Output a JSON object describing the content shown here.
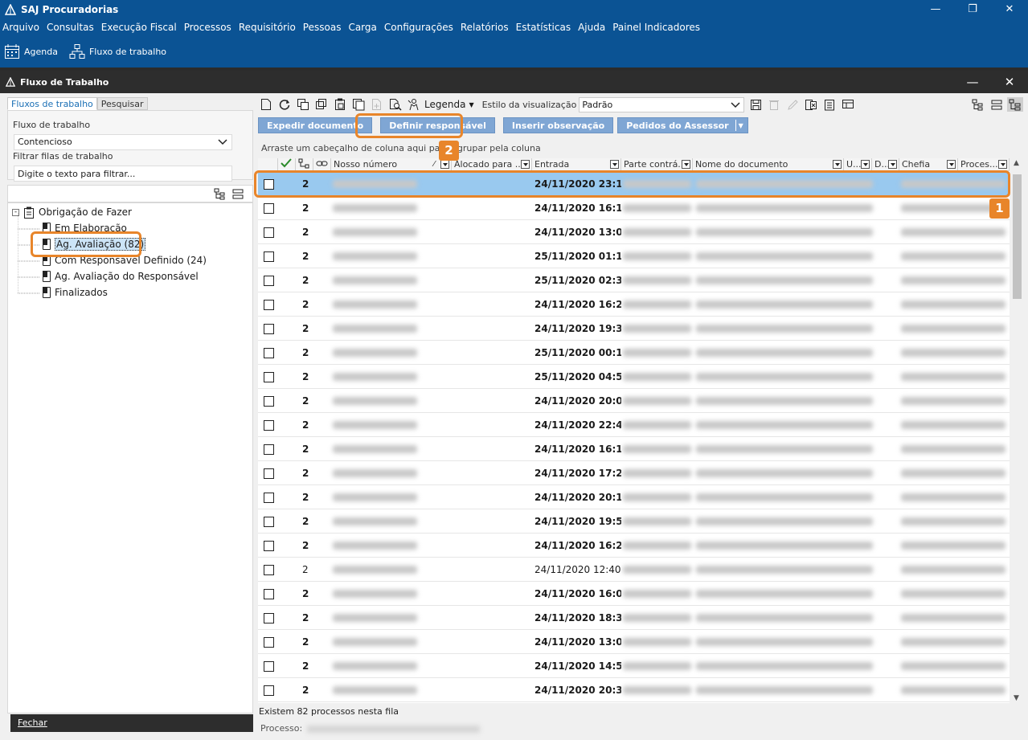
{
  "app": {
    "title": "SAJ Procuradorias"
  },
  "window_controls": {
    "minimize": "—",
    "restore": "❐",
    "close": "✕"
  },
  "menu": [
    "Arquivo",
    "Consultas",
    "Execução Fiscal",
    "Processos",
    "Requisitório",
    "Pessoas",
    "Carga",
    "Configurações",
    "Relatórios",
    "Estatísticas",
    "Ajuda",
    "Painel Indicadores"
  ],
  "quickbar": {
    "agenda": "Agenda",
    "workflow": "Fluxo de trabalho"
  },
  "window": {
    "title": "Fluxo de Trabalho"
  },
  "left": {
    "tabs": [
      "Fluxos de trabalho",
      "Pesquisar"
    ],
    "workflow_label": "Fluxo de trabalho",
    "workflow_value": "Contencioso",
    "filter_label": "Filtrar filas de trabalho",
    "filter_placeholder": "Digite o texto para filtrar...",
    "tree": {
      "root": "Obrigação de Fazer",
      "children": [
        "Em Elaboração",
        "Ag. Avaliação (82)",
        "Com Responsável Definido (24)",
        "Ag. Avaliação do Responsável",
        "Finalizados"
      ]
    },
    "close_button": "Fechar"
  },
  "toolbar": {
    "legend": "Legenda",
    "style_label": "Estilo da visualização",
    "style_value": "Padrão"
  },
  "actions": [
    "Expedir documento",
    "Definir responsável",
    "Inserir observação",
    "Pedidos do Assessor"
  ],
  "group_hint": "Arraste um cabeçalho de coluna aqui para agrupar pela coluna",
  "columns": [
    "Nosso número",
    "Alocado para ...",
    "Entrada",
    "Parte contrá...",
    "Nome do documento",
    "U...",
    "D...",
    "Chefia",
    "Proces..."
  ],
  "rows": [
    {
      "count": "2",
      "entrada": "24/11/2020 23:1",
      "bold": true
    },
    {
      "count": "2",
      "entrada": "24/11/2020 16:1",
      "bold": true
    },
    {
      "count": "2",
      "entrada": "24/11/2020 13:0",
      "bold": true
    },
    {
      "count": "2",
      "entrada": "25/11/2020 01:1",
      "bold": true
    },
    {
      "count": "2",
      "entrada": "25/11/2020 02:3",
      "bold": true
    },
    {
      "count": "2",
      "entrada": "24/11/2020 16:2",
      "bold": true
    },
    {
      "count": "2",
      "entrada": "24/11/2020 19:3",
      "bold": true
    },
    {
      "count": "2",
      "entrada": "25/11/2020 00:1",
      "bold": true
    },
    {
      "count": "2",
      "entrada": "25/11/2020 04:5",
      "bold": true
    },
    {
      "count": "2",
      "entrada": "24/11/2020 20:0",
      "bold": true
    },
    {
      "count": "2",
      "entrada": "24/11/2020 22:4",
      "bold": true
    },
    {
      "count": "2",
      "entrada": "24/11/2020 16:1",
      "bold": true
    },
    {
      "count": "2",
      "entrada": "24/11/2020 17:2",
      "bold": true
    },
    {
      "count": "2",
      "entrada": "24/11/2020 20:1",
      "bold": true
    },
    {
      "count": "2",
      "entrada": "24/11/2020 19:5",
      "bold": true
    },
    {
      "count": "2",
      "entrada": "24/11/2020 16:2",
      "bold": true
    },
    {
      "count": "2",
      "entrada": "24/11/2020 12:40",
      "bold": false
    },
    {
      "count": "2",
      "entrada": "24/11/2020 16:0",
      "bold": true
    },
    {
      "count": "2",
      "entrada": "24/11/2020 18:3",
      "bold": true
    },
    {
      "count": "2",
      "entrada": "24/11/2020 13:0",
      "bold": true
    },
    {
      "count": "2",
      "entrada": "24/11/2020 14:5",
      "bold": true
    },
    {
      "count": "2",
      "entrada": "24/11/2020 20:3",
      "bold": true
    }
  ],
  "status": {
    "summary": "Existem 82 processos nesta fila",
    "process_label": "Processo:"
  },
  "badges": {
    "one": "1",
    "two": "2"
  },
  "colors": {
    "title_bar": "#0b5394",
    "window_bar": "#2d2d2d",
    "action_button": "#7fa6d4",
    "selection": "#99c9ef",
    "highlight": "#e8852a"
  }
}
